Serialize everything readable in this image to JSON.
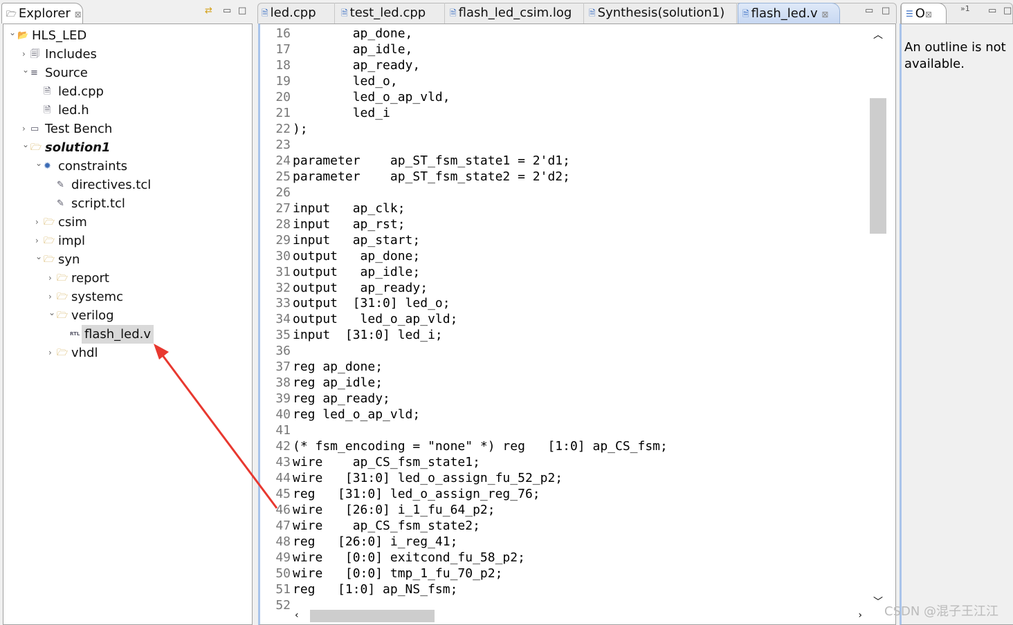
{
  "explorer": {
    "title": "Explorer",
    "close": "⊠",
    "tree": [
      {
        "label": "HLS_LED",
        "level": 0,
        "expander": "v",
        "icon": "project-folder-icon",
        "glyph": "📂"
      },
      {
        "label": "Includes",
        "level": 1,
        "expander": ">",
        "icon": "includes-icon",
        "glyph": "🗐"
      },
      {
        "label": "Source",
        "level": 1,
        "expander": "v",
        "icon": "source-icon",
        "glyph": "≡"
      },
      {
        "label": "led.cpp",
        "level": 2,
        "expander": "",
        "icon": "cpp-file-icon",
        "glyph": "🗎"
      },
      {
        "label": "led.h",
        "level": 2,
        "expander": "",
        "icon": "header-file-icon",
        "glyph": "🗎"
      },
      {
        "label": "Test Bench",
        "level": 1,
        "expander": ">",
        "icon": "testbench-icon",
        "glyph": "▭"
      },
      {
        "label": "solution1",
        "level": 1,
        "expander": "v",
        "icon": "folder-icon",
        "glyph": "🗁",
        "bold": true
      },
      {
        "label": "constraints",
        "level": 2,
        "expander": "v",
        "icon": "gear-icon",
        "glyph": "✹"
      },
      {
        "label": "directives.tcl",
        "level": 3,
        "expander": "",
        "icon": "tcl-file-icon",
        "glyph": "✎"
      },
      {
        "label": "script.tcl",
        "level": 3,
        "expander": "",
        "icon": "tcl-file-icon",
        "glyph": "✎"
      },
      {
        "label": "csim",
        "level": 2,
        "expander": ">",
        "icon": "folder-icon",
        "glyph": "🗁"
      },
      {
        "label": "impl",
        "level": 2,
        "expander": ">",
        "icon": "folder-icon",
        "glyph": "🗁"
      },
      {
        "label": "syn",
        "level": 2,
        "expander": "v",
        "icon": "folder-icon",
        "glyph": "🗁"
      },
      {
        "label": "report",
        "level": 3,
        "expander": ">",
        "icon": "folder-icon",
        "glyph": "🗁"
      },
      {
        "label": "systemc",
        "level": 3,
        "expander": ">",
        "icon": "folder-icon",
        "glyph": "🗁"
      },
      {
        "label": "verilog",
        "level": 3,
        "expander": "v",
        "icon": "folder-icon",
        "glyph": "🗁"
      },
      {
        "label": "flash_led.v",
        "level": 4,
        "expander": "",
        "icon": "rtl-file-icon",
        "glyph": "RTL",
        "selected": true
      },
      {
        "label": "vhdl",
        "level": 3,
        "expander": ">",
        "icon": "folder-icon",
        "glyph": "🗁"
      }
    ]
  },
  "editor": {
    "tabs": [
      {
        "label": "led.cpp",
        "icon": "cpp-file-icon"
      },
      {
        "label": "test_led.cpp",
        "icon": "cpp-file-icon"
      },
      {
        "label": "flash_led_csim.log",
        "icon": "log-file-icon"
      },
      {
        "label": "Synthesis(solution1)",
        "icon": "report-icon"
      },
      {
        "label": "flash_led.v",
        "icon": "rtl-file-icon",
        "active": true,
        "close": "⊠"
      }
    ],
    "lines": [
      {
        "n": "16",
        "t": "        ap_done,"
      },
      {
        "n": "17",
        "t": "        ap_idle,"
      },
      {
        "n": "18",
        "t": "        ap_ready,"
      },
      {
        "n": "19",
        "t": "        led_o,"
      },
      {
        "n": "20",
        "t": "        led_o_ap_vld,"
      },
      {
        "n": "21",
        "t": "        led_i"
      },
      {
        "n": "22",
        "t": ");"
      },
      {
        "n": "23",
        "t": ""
      },
      {
        "n": "24",
        "t": "parameter    ap_ST_fsm_state1 = 2'd1;"
      },
      {
        "n": "25",
        "t": "parameter    ap_ST_fsm_state2 = 2'd2;"
      },
      {
        "n": "26",
        "t": ""
      },
      {
        "n": "27",
        "t": "input   ap_clk;"
      },
      {
        "n": "28",
        "t": "input   ap_rst;"
      },
      {
        "n": "29",
        "t": "input   ap_start;"
      },
      {
        "n": "30",
        "t": "output   ap_done;"
      },
      {
        "n": "31",
        "t": "output   ap_idle;"
      },
      {
        "n": "32",
        "t": "output   ap_ready;"
      },
      {
        "n": "33",
        "t": "output  [31:0] led_o;"
      },
      {
        "n": "34",
        "t": "output   led_o_ap_vld;"
      },
      {
        "n": "35",
        "t": "input  [31:0] led_i;"
      },
      {
        "n": "36",
        "t": ""
      },
      {
        "n": "37",
        "t": "reg ap_done;"
      },
      {
        "n": "38",
        "t": "reg ap_idle;"
      },
      {
        "n": "39",
        "t": "reg ap_ready;"
      },
      {
        "n": "40",
        "t": "reg led_o_ap_vld;"
      },
      {
        "n": "41",
        "t": ""
      },
      {
        "n": "42",
        "t": "(* fsm_encoding = \"none\" *) reg   [1:0] ap_CS_fsm;"
      },
      {
        "n": "43",
        "t": "wire    ap_CS_fsm_state1;"
      },
      {
        "n": "44",
        "t": "wire   [31:0] led_o_assign_fu_52_p2;"
      },
      {
        "n": "45",
        "t": "reg   [31:0] led_o_assign_reg_76;"
      },
      {
        "n": "46",
        "t": "wire   [26:0] i_1_fu_64_p2;"
      },
      {
        "n": "47",
        "t": "wire    ap_CS_fsm_state2;"
      },
      {
        "n": "48",
        "t": "reg   [26:0] i_reg_41;"
      },
      {
        "n": "49",
        "t": "wire   [0:0] exitcond_fu_58_p2;"
      },
      {
        "n": "50",
        "t": "wire   [0:0] tmp_1_fu_70_p2;"
      },
      {
        "n": "51",
        "t": "reg   [1:0] ap_NS_fsm;"
      },
      {
        "n": "52",
        "t": ""
      }
    ]
  },
  "outline": {
    "tab": "O",
    "close": "⊠",
    "overflow": "»1",
    "message": "An outline is not available."
  },
  "watermark": "CSDN @混子王江江",
  "colors": {
    "annotation_arrow": "#e8382f",
    "selection": "#d9d9d9",
    "active_tab": "#c7d8f2"
  }
}
